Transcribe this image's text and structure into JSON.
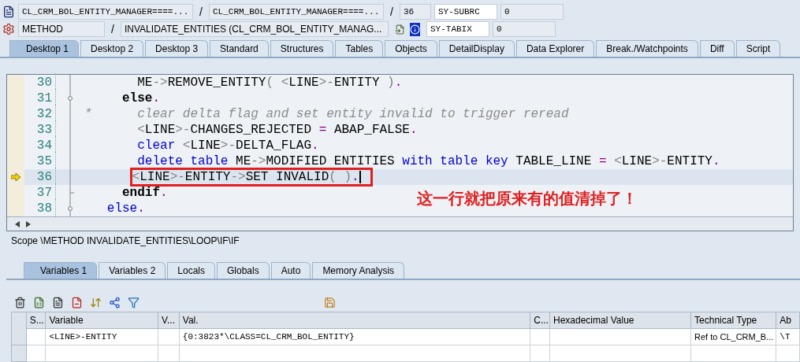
{
  "header_rows": [
    {
      "items": [
        {
          "kind": "code_field",
          "text": "CL_CRM_BOL_ENTITY_MANAGER====..."
        },
        {
          "kind": "sep",
          "text": "/"
        },
        {
          "kind": "code_field",
          "text": "CL_CRM_BOL_ENTITY_MANAGER====..."
        },
        {
          "kind": "sep",
          "text": "/"
        },
        {
          "kind": "code_field",
          "text": "36"
        },
        {
          "kind": "sysvar",
          "text": "SY-SUBRC"
        },
        {
          "kind": "code_field",
          "text": "0"
        }
      ]
    },
    {
      "items": [
        {
          "kind": "text_field",
          "text": "METHOD"
        },
        {
          "kind": "sep",
          "text": "/"
        },
        {
          "kind": "text_field",
          "text": "INVALIDATE_ENTITIES (CL_CRM_BOL_ENTITY_MANAG..."
        },
        {
          "kind": "icon_buttons"
        },
        {
          "kind": "sysvar",
          "text": "SY-TABIX"
        },
        {
          "kind": "code_field",
          "text": "0"
        }
      ]
    }
  ],
  "tabs": [
    {
      "label": "Desktop 1",
      "selected": true
    },
    {
      "label": "Desktop 2",
      "selected": false
    },
    {
      "label": "Desktop 3",
      "selected": false
    },
    {
      "label": "Standard",
      "selected": false
    },
    {
      "label": "Structures",
      "selected": false
    },
    {
      "label": "Tables",
      "selected": false
    },
    {
      "label": "Objects",
      "selected": false
    },
    {
      "label": "DetailDisplay",
      "selected": false
    },
    {
      "label": "Data Explorer",
      "selected": false
    },
    {
      "label": "Break./Watchpoints",
      "selected": false
    },
    {
      "label": "Diff",
      "selected": false
    },
    {
      "label": "Script",
      "selected": false
    }
  ],
  "code": {
    "lines": [
      {
        "number": "30",
        "current": false,
        "annotated": false,
        "fold_start": false,
        "fold_end": false,
        "tokens": [
          {
            "kind": "plain",
            "text": "       ME"
          },
          {
            "kind": "op",
            "text": "->"
          },
          {
            "kind": "plain",
            "text": "REMOVE_ENTITY"
          },
          {
            "kind": "op",
            "text": "( <"
          },
          {
            "kind": "plain",
            "text": "LINE"
          },
          {
            "kind": "op",
            "text": ">-"
          },
          {
            "kind": "plain",
            "text": "ENTITY"
          },
          {
            "kind": "op",
            "text": " )"
          },
          {
            "kind": "dot",
            "text": "."
          }
        ]
      },
      {
        "number": "31",
        "current": false,
        "annotated": false,
        "fold_start": true,
        "fold_end": false,
        "tokens": [
          {
            "kind": "bold",
            "text": "     else"
          },
          {
            "kind": "dot",
            "text": "."
          }
        ]
      },
      {
        "number": "32",
        "current": false,
        "annotated": false,
        "fold_start": false,
        "fold_end": false,
        "tokens": [
          {
            "kind": "comment",
            "text": "*      clear delta flag and set entity invalid to trigger reread"
          }
        ]
      },
      {
        "number": "33",
        "current": false,
        "annotated": false,
        "fold_start": false,
        "fold_end": false,
        "tokens": [
          {
            "kind": "op",
            "text": "       <"
          },
          {
            "kind": "plain",
            "text": "LINE"
          },
          {
            "kind": "op",
            "text": ">-"
          },
          {
            "kind": "plain",
            "text": "CHANGES_REJECTED "
          },
          {
            "kind": "dot",
            "text": "="
          },
          {
            "kind": "plain",
            "text": " ABAP_FALSE"
          },
          {
            "kind": "dot",
            "text": "."
          }
        ]
      },
      {
        "number": "34",
        "current": false,
        "annotated": false,
        "fold_start": false,
        "fold_end": false,
        "tokens": [
          {
            "kind": "kw",
            "text": "       clear"
          },
          {
            "kind": "op",
            "text": " <"
          },
          {
            "kind": "plain",
            "text": "LINE"
          },
          {
            "kind": "op",
            "text": ">-"
          },
          {
            "kind": "plain",
            "text": "DELTA_FLAG"
          },
          {
            "kind": "dot",
            "text": "."
          }
        ]
      },
      {
        "number": "35",
        "current": false,
        "annotated": false,
        "fold_start": false,
        "fold_end": false,
        "tokens": [
          {
            "kind": "kw",
            "text": "       delete table"
          },
          {
            "kind": "plain",
            "text": " ME"
          },
          {
            "kind": "op",
            "text": "->"
          },
          {
            "kind": "plain",
            "text": "MODIFIED ENTITIES "
          },
          {
            "kind": "kw",
            "text": "with table key"
          },
          {
            "kind": "plain",
            "text": " TABLE_LINE "
          },
          {
            "kind": "dot",
            "text": "="
          },
          {
            "kind": "op",
            "text": " <"
          },
          {
            "kind": "plain",
            "text": "LINE"
          },
          {
            "kind": "op",
            "text": ">-"
          },
          {
            "kind": "plain",
            "text": "ENTITY"
          },
          {
            "kind": "dot",
            "text": "."
          }
        ]
      },
      {
        "number": "36",
        "current": true,
        "annotated": true,
        "fold_start": false,
        "fold_end": false,
        "tokens": [
          {
            "kind": "op",
            "text": "      <"
          },
          {
            "kind": "plain",
            "text": "LINE"
          },
          {
            "kind": "op",
            "text": ">-"
          },
          {
            "kind": "plain",
            "text": "ENTITY"
          },
          {
            "kind": "op",
            "text": "->"
          },
          {
            "kind": "plain",
            "text": "SET INVALID"
          },
          {
            "kind": "op",
            "text": "( )"
          },
          {
            "kind": "dot",
            "text": "."
          }
        ]
      },
      {
        "number": "37",
        "current": false,
        "annotated": false,
        "fold_start": false,
        "fold_end": true,
        "tokens": [
          {
            "kind": "bold",
            "text": "     endif"
          },
          {
            "kind": "dot",
            "text": "."
          }
        ]
      },
      {
        "number": "38",
        "current": false,
        "annotated": false,
        "fold_start": true,
        "fold_end": false,
        "tokens": [
          {
            "kind": "kw",
            "text": "   else"
          },
          {
            "kind": "dot",
            "text": "."
          }
        ]
      }
    ],
    "note": "这一行就把原来有的值清掉了！"
  },
  "scope": "Scope \\METHOD INVALIDATE_ENTITIES\\LOOP\\IF\\IF",
  "lower_tabs": [
    {
      "label": "Variables 1",
      "selected": true
    },
    {
      "label": "Variables 2",
      "selected": false
    },
    {
      "label": "Locals",
      "selected": false
    },
    {
      "label": "Globals",
      "selected": false
    },
    {
      "label": "Auto",
      "selected": false
    },
    {
      "label": "Memory Analysis",
      "selected": false
    }
  ],
  "table": {
    "columns": [
      "S...",
      "Variable",
      "V...",
      "Val.",
      "C...",
      "Hexadecimal Value",
      "Technical Type",
      "Ab"
    ],
    "rows": [
      [
        "",
        "<LINE>-ENTITY",
        "",
        "{0:3823*\\CLASS=CL_CRM_BOL_ENTITY}",
        "",
        "",
        "Ref to CL_CRM_B...",
        "\\T"
      ],
      [
        "",
        "",
        "",
        "",
        "",
        "",
        "",
        ""
      ]
    ]
  }
}
